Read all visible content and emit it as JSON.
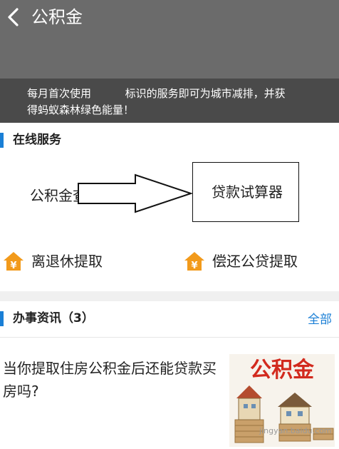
{
  "header": {
    "title": "公积金",
    "back_icon": "chevron-left-icon"
  },
  "notice": {
    "text": "每月首次使用          标识的服务即可为城市减排，并获\n得蚂蚁森林绿色能量！"
  },
  "online_services": {
    "title": "在线服务",
    "items": [
      {
        "label": "公积金查询"
      },
      {
        "label": "贷款试算器"
      }
    ],
    "rows": [
      {
        "label": "离退休提取",
        "icon": "yen-house-icon"
      },
      {
        "label": "偿还公贷提取",
        "icon": "yen-house-icon"
      }
    ]
  },
  "news": {
    "title": "办事资讯（3）",
    "more_label": "全部",
    "articles": [
      {
        "title": "当你提取住房公积金后还能贷款买房吗?",
        "thumb_text": "公积金"
      }
    ]
  },
  "watermark": "jingyan.baidu.com",
  "colors": {
    "header_bg": "#6b6b6b",
    "notice_bg": "#4a4a4a",
    "accent": "#1a7fd6",
    "icon_orange": "#f29a1b",
    "thumb_red": "#d22a1e"
  }
}
